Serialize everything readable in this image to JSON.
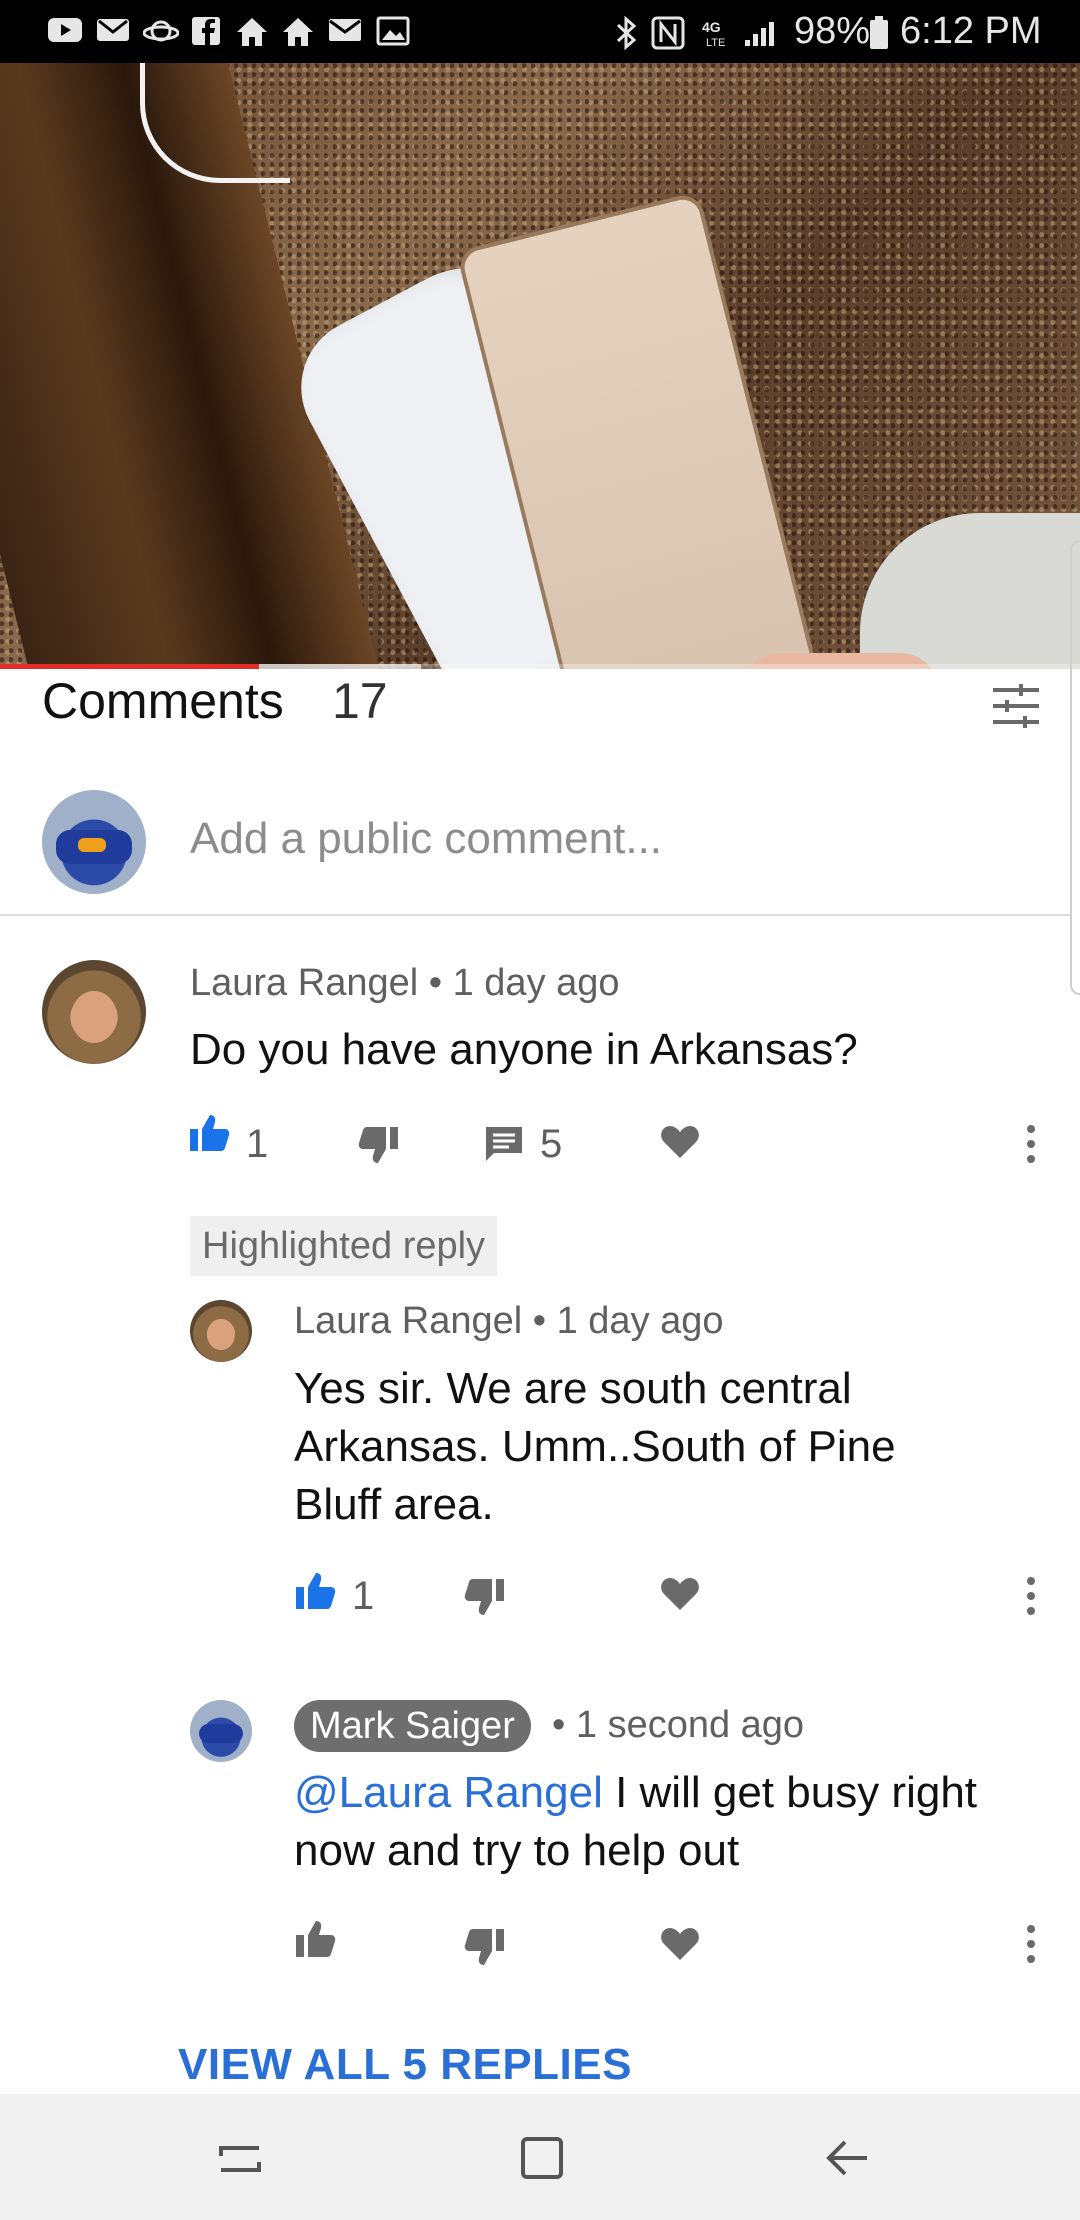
{
  "status_bar": {
    "battery": "98%",
    "time": "6:12 PM",
    "network": "4G LTE",
    "left_icons": [
      "youtube-icon",
      "gmail-icon",
      "saturn-icon",
      "facebook-icon",
      "home-icon",
      "home-icon",
      "mail-icon",
      "image-icon"
    ],
    "right_icons": [
      "bluetooth-icon",
      "nfc-icon",
      "lte-icon",
      "signal-icon",
      "battery-icon"
    ]
  },
  "video": {
    "progress_fraction": 0.24,
    "buffered_fraction": 0.39
  },
  "comments": {
    "title": "Comments",
    "count": "17",
    "add_placeholder": "Add a public comment...",
    "view_all_label": "VIEW ALL 5 REPLIES"
  },
  "thread": {
    "top": {
      "author": "Laura Rangel",
      "time": "1 day ago",
      "text": "Do you have anyone in Arkansas?",
      "likes": "1",
      "replies": "5"
    },
    "highlighted_label": "Highlighted reply",
    "reply1": {
      "author": "Laura Rangel",
      "time": "1 day ago",
      "text_lines": [
        "Yes sir. We are south central",
        "Arkansas.  Umm..South of Pine",
        "Bluff area."
      ],
      "likes": "1"
    },
    "reply2": {
      "author": "Mark Saiger",
      "time": "1 second ago",
      "mention": "@Laura Rangel",
      "text_line1": " I will get busy right",
      "text_line2": "now and try to help out"
    }
  },
  "colors": {
    "accent_blue": "#2a6fd6",
    "progress_red": "#e52d27",
    "like_active": "#1a73e8"
  },
  "nav_icons": [
    "recent-apps-icon",
    "home-square-icon",
    "back-icon"
  ]
}
